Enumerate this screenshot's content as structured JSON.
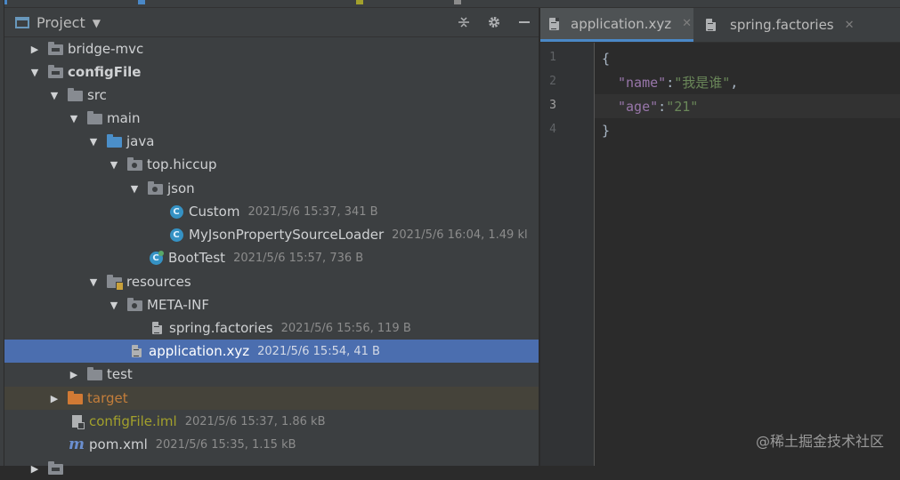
{
  "project": {
    "title": "Project",
    "tree": [
      {
        "id": "bridge-mvc",
        "label": "bridge-mvc",
        "meta": "",
        "expanded": false
      },
      {
        "id": "configFile",
        "label": "configFile",
        "meta": "",
        "expanded": true
      },
      {
        "id": "src",
        "label": "src",
        "meta": "",
        "expanded": true
      },
      {
        "id": "main",
        "label": "main",
        "meta": "",
        "expanded": true
      },
      {
        "id": "java",
        "label": "java",
        "meta": "",
        "expanded": true
      },
      {
        "id": "top-hiccup",
        "label": "top.hiccup",
        "meta": "",
        "expanded": true
      },
      {
        "id": "json",
        "label": "json",
        "meta": "",
        "expanded": true
      },
      {
        "id": "Custom",
        "label": "Custom",
        "meta": "2021/5/6 15:37, 341 B"
      },
      {
        "id": "MyJsonPropertySourceLoader",
        "label": "MyJsonPropertySourceLoader",
        "meta": "2021/5/6 16:04, 1.49 kl"
      },
      {
        "id": "BootTest",
        "label": "BootTest",
        "meta": "2021/5/6 15:57, 736 B"
      },
      {
        "id": "resources",
        "label": "resources",
        "meta": "",
        "expanded": true
      },
      {
        "id": "META-INF",
        "label": "META-INF",
        "meta": "",
        "expanded": true
      },
      {
        "id": "spring-factories",
        "label": "spring.factories",
        "meta": "2021/5/6 15:56, 119 B"
      },
      {
        "id": "application-xyz",
        "label": "application.xyz",
        "meta": "2021/5/6 15:54, 41 B",
        "selected": true
      },
      {
        "id": "test",
        "label": "test",
        "meta": "",
        "expanded": false
      },
      {
        "id": "target",
        "label": "target",
        "meta": "",
        "expanded": false
      },
      {
        "id": "configFile-iml",
        "label": "configFile.iml",
        "meta": "2021/5/6 15:37, 1.86 kB"
      },
      {
        "id": "pom-xml",
        "label": "pom.xml",
        "meta": "2021/5/6 15:35, 1.15 kB"
      }
    ]
  },
  "editor": {
    "tabs": [
      {
        "label": "application.xyz",
        "active": true
      },
      {
        "label": "spring.factories",
        "active": false
      }
    ],
    "line_numbers": [
      "1",
      "2",
      "3",
      "4"
    ],
    "code": {
      "l1": "{",
      "l2_key": "\"name\"",
      "l2_colon": ":",
      "l2_val": "\"我是谁\"",
      "l2_comma": ",",
      "l3_key": "\"age\"",
      "l3_colon": ":",
      "l3_val": "\"21\"",
      "l4": "}"
    },
    "current_line": 3
  },
  "watermark": "@稀土掘金技术社区",
  "colors": {
    "selection": "#4b6eaf",
    "accent": "#4a88c7",
    "string": "#6a8759",
    "key": "#9876aa"
  }
}
